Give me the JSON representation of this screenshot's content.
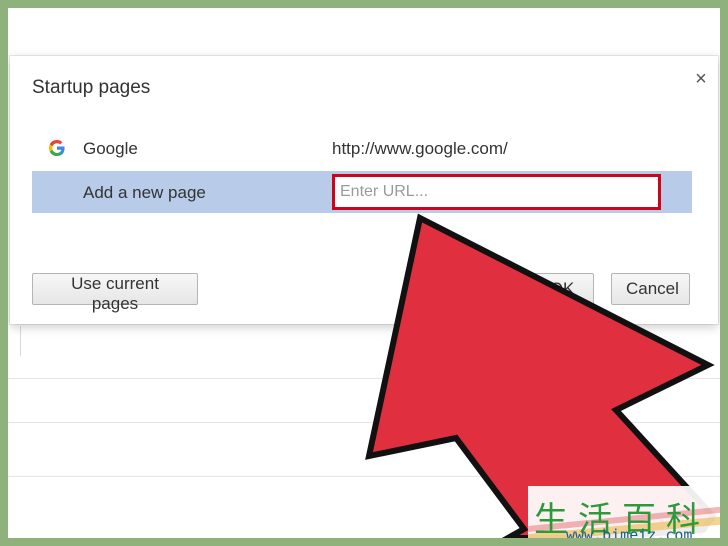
{
  "dialog": {
    "title": "Startup pages",
    "close_symbol": "×",
    "pages": [
      {
        "name": "Google",
        "url": "http://www.google.com/",
        "favicon": "google-g-icon"
      }
    ],
    "new_page": {
      "label": "Add a new page",
      "placeholder": "Enter URL..."
    },
    "buttons": {
      "use_current": "Use current pages",
      "ok": "OK",
      "cancel": "Cancel"
    }
  },
  "annotation": {
    "arrow_color": "#e0303f",
    "highlight_color": "#d0021b"
  },
  "watermark": {
    "characters": "生活百科",
    "url": "www.bimeiz.com"
  },
  "colors": {
    "selected_row": "#b8cbe8",
    "frame": "#8fb27c"
  }
}
